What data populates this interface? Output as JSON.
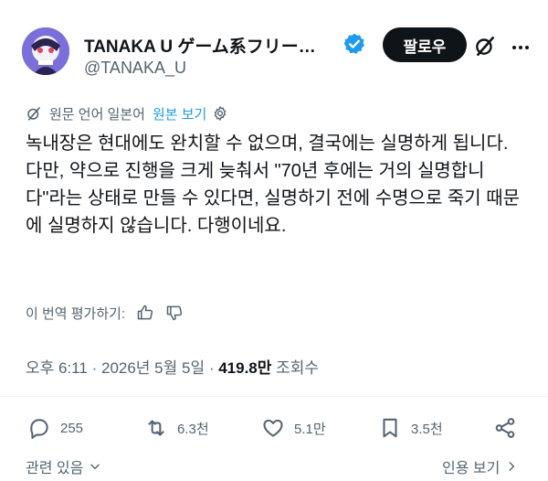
{
  "author": {
    "name": "TANAKA U ゲーム系フリー…",
    "handle": "@TANAKA_U",
    "verified": true,
    "avatar": "avatar-illustration"
  },
  "follow_label": "팔로우",
  "translation": {
    "original_language": "원문 언어 일본어",
    "show_original": "원본 보기"
  },
  "tweet": {
    "lines": [
      "녹내장은 현대에도 완치할 수 없으며, 결국에는 실명하게 됩니다.",
      "다만, 약으로 진행을 크게 늦춰서 \"70년 후에는 거의 실명합니다\"라는 상태로 만들 수 있다면, 실명하기 전에 수명으로 죽기 때문에 실명하지 않습니다. 다행이네요."
    ]
  },
  "rate": {
    "label": "이 번역 평가하기:"
  },
  "meta": {
    "time": "오후 6:11",
    "sep1": "·",
    "date": "2026년 5월 5일",
    "sep2": "·",
    "views_count": "419.8만",
    "views_label": "조회수"
  },
  "actions": {
    "replies": "255",
    "reposts": "6.3천",
    "likes": "5.1만",
    "bookmarks": "3.5천"
  },
  "bottom": {
    "related": "관련 있음",
    "quotes": "인용 보기"
  },
  "colors": {
    "accent": "#1d9bf0",
    "text": "#0f1419",
    "muted": "#536471",
    "divider": "#eff3f4"
  },
  "icons": [
    "verified-badge-icon",
    "grok-icon",
    "more-icon",
    "globe-icon",
    "gear-icon",
    "thumbs-up-icon",
    "thumbs-down-icon",
    "reply-icon",
    "repost-icon",
    "like-icon",
    "bookmark-icon",
    "share-icon",
    "chevron-down-icon",
    "chevron-right-icon"
  ]
}
